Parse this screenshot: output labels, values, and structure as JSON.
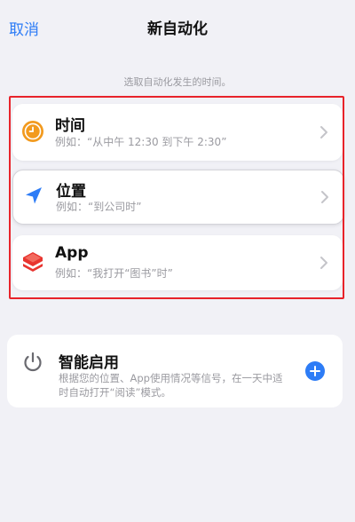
{
  "nav": {
    "cancel_label": "取消",
    "title": "新自动化"
  },
  "hint_text": "选取自动化发生的时间。",
  "triggers": [
    {
      "title": "时间",
      "example": "例如：“从中午 12:30 到下午 2:30”",
      "icon": "clock-icon",
      "icon_color": "#f29a1e"
    },
    {
      "title": "位置",
      "example": "例如：“到公司时”",
      "icon": "location-arrow-icon",
      "icon_color": "#2d7cf6"
    },
    {
      "title": "App",
      "example": "例如：“我打开“图书”时”",
      "icon": "app-layers-icon",
      "icon_color": "#e8342f"
    }
  ],
  "smart": {
    "title": "智能启用",
    "description": "根据您的位置、App使用情况等信号，在一天中适时自动打开“阅读”模式。",
    "icon": "power-icon"
  },
  "colors": {
    "accent": "#2d7cf6",
    "highlight": "#e8232a",
    "background": "#f1f1f6"
  }
}
